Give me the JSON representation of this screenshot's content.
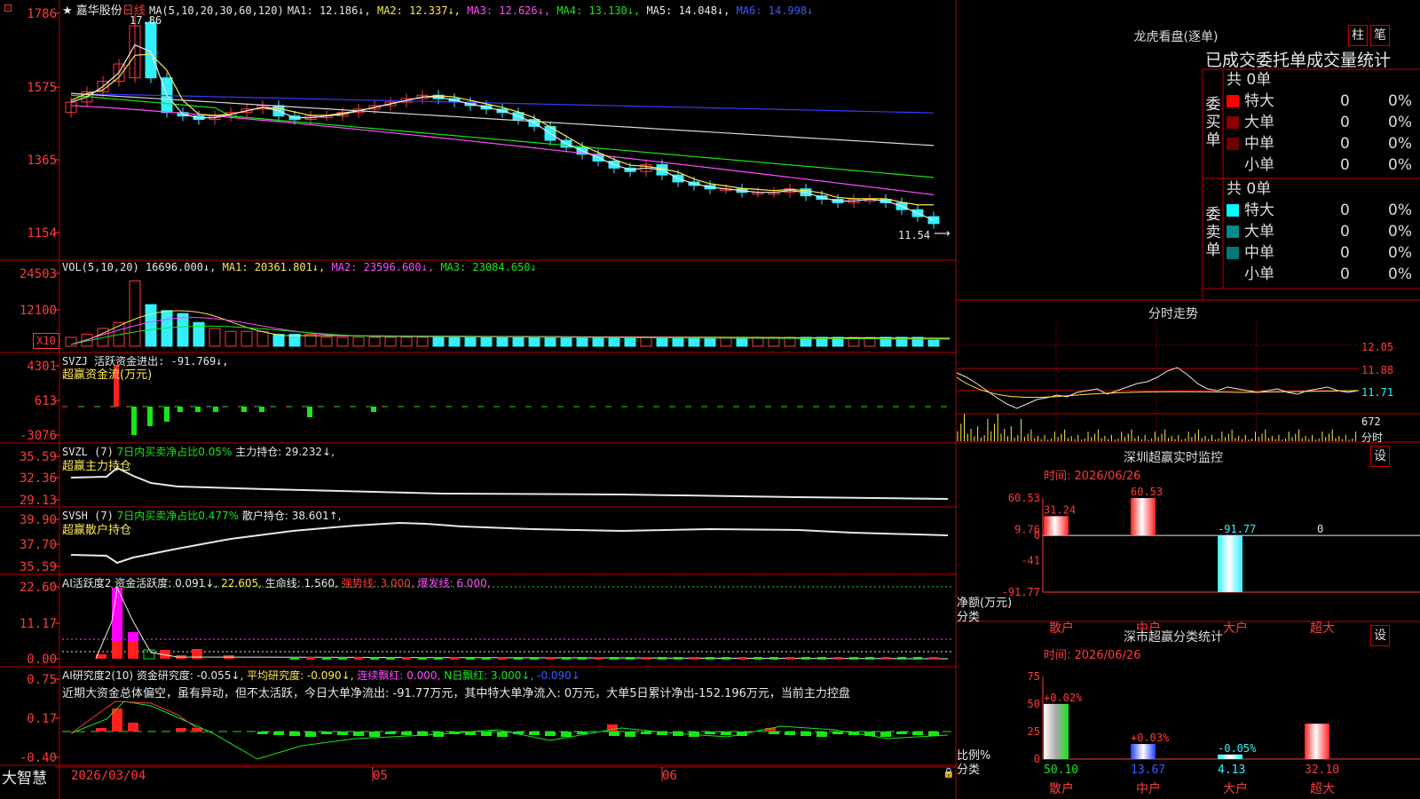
{
  "header": {
    "star": "★",
    "stock_name": "嘉华股份",
    "period": "日线",
    "ma_label": "MA(5,10,20,30,60,120)",
    "ma_values": [
      {
        "label": "MA1: 12.186↓,",
        "color": "#e8e8e8"
      },
      {
        "label": "MA2: 12.337↓,",
        "color": "#ffe94a"
      },
      {
        "label": "MA3: 12.626↓,",
        "color": "#ff4dff"
      },
      {
        "label": "MA4: 13.130↓,",
        "color": "#19e619"
      },
      {
        "label": "MA5: 14.048↓,",
        "color": "#e8e8e8"
      },
      {
        "label": "MA6: 14.998↓",
        "color": "#3a5bff"
      }
    ],
    "high_label": "17.86",
    "low_label": "11.54"
  },
  "axes": {
    "price": [
      "1786",
      "1575",
      "1365",
      "1154"
    ],
    "vol": [
      "24503",
      "12100"
    ],
    "vol_unit": "X10",
    "svzj": [
      "4301",
      "613",
      "-3076"
    ],
    "svzl": [
      "35.59",
      "32.36",
      "29.13"
    ],
    "svsh": [
      "39.90",
      "37.70",
      "35.59"
    ],
    "ai1": [
      "22.60",
      "11.17",
      "0.00"
    ],
    "ai2": [
      "0.75",
      "0.17",
      "-0.40"
    ]
  },
  "panes": {
    "vol": {
      "name": "VOL(5,10,20)",
      "value": "16696.000↓,",
      "ma1": "MA1: 20361.801↓,",
      "ma2": "MA2: 23596.600↓,",
      "ma3": "MA3: 23084.650↓"
    },
    "svzj": {
      "name": "SVZJ",
      "desc": "活跃资金进出: -91.769↓,",
      "sub": "超赢资金流(万元)"
    },
    "svzl": {
      "name": "SVZL (7)",
      "desc": "7日内买卖净占比0.05%",
      "hold": "主力持仓: 29.232↓,",
      "sub": "超赢主力持仓"
    },
    "svsh": {
      "name": "SVSH (7)",
      "desc": "7日内买卖净占比0.477%",
      "hold": "散户持仓: 38.601↑,",
      "sub": "超赢散户持仓"
    },
    "ai1": {
      "name": "AI活跃度2",
      "v1": "资金活跃度: 0.091↓,",
      "v2": "22.605,",
      "v3": "生命线: 1.560,",
      "v4": "强势线: 3.000,",
      "v5": "爆发线: 6.000,"
    },
    "ai2": {
      "name": "AI研究度2(10)",
      "v1": "资金研究度: -0.055↓,",
      "v2": "平均研究度: -0.090↓,",
      "v3": "连续飘红: 0.000,",
      "v4": "N日飘红: 3.000↓,",
      "v5": "-0.090↓",
      "summary": "近期大资金总体偏空，虽有异动，但不太活跃，今日大单净流出: -91.77万元，其中特大单净流入: 0万元，大单5日累计净出-152.196万元，当前主力控盘"
    }
  },
  "footer": {
    "brand": "大智慧",
    "dates": [
      "2026/03/04",
      "05",
      "06"
    ]
  },
  "right": {
    "lhb_title": "龙虎看盘(逐单)",
    "btn_zhu": "柱",
    "btn_bi": "笔",
    "stat_title": "已成交委托单成交量统计",
    "buy_label": "委买单",
    "sell_label": "委卖单",
    "buy_total": "共 0单",
    "sell_total": "共 0单",
    "buy_rows": [
      {
        "name": "特大",
        "count": "0",
        "pct": "0%",
        "color": "#ff0000"
      },
      {
        "name": "大单",
        "count": "0",
        "pct": "0%",
        "color": "#8b0000"
      },
      {
        "name": "中单",
        "count": "0",
        "pct": "0%",
        "color": "#6e0000"
      },
      {
        "name": "小单",
        "count": "0",
        "pct": "0%",
        "color": "#000000"
      }
    ],
    "sell_rows": [
      {
        "name": "特大",
        "count": "0",
        "pct": "0%",
        "color": "#00ffff"
      },
      {
        "name": "大单",
        "count": "0",
        "pct": "0%",
        "color": "#008b8b"
      },
      {
        "name": "中单",
        "count": "0",
        "pct": "0%",
        "color": "#007878"
      },
      {
        "name": "小单",
        "count": "0",
        "pct": "0%",
        "color": "#000000"
      }
    ],
    "fenshi_title": "分时走势",
    "fenshi_axis": [
      "12.05",
      "11.88",
      "11.71",
      "672"
    ],
    "fenshi_unit": "分时",
    "sz_monitor_title": "深圳超赢实时监控",
    "sz_btn": "设",
    "time_label": "时间: 2026/06/26",
    "monitor_axis": [
      "60.53",
      "9.76",
      "0",
      "-41",
      "-91.77"
    ],
    "monitor_yunit": "净额(万元)",
    "monitor_xunit": "分类",
    "class_stat_title": "深市超赢分类统计",
    "class_axis": [
      "75",
      "50",
      "25",
      "0"
    ],
    "class_yunit": "比例%",
    "class_xunit": "分类",
    "categories": [
      "散户",
      "中户",
      "大户",
      "超大"
    ]
  },
  "chart_data": [
    {
      "type": "candlestick",
      "title": "嘉华股份 日线",
      "ylim": [
        11.54,
        17.86
      ],
      "y_ticks": [
        17.86,
        15.75,
        13.65,
        11.54
      ],
      "x_ticks": [
        "2026/03/04",
        "05",
        "06"
      ],
      "annotations": [
        {
          "text": "17.86",
          "kind": "high"
        },
        {
          "text": "11.54",
          "kind": "low"
        }
      ],
      "series": [
        {
          "name": "MA1",
          "latest": 12.186
        },
        {
          "name": "MA2",
          "latest": 12.337
        },
        {
          "name": "MA3",
          "latest": 12.626
        },
        {
          "name": "MA4",
          "latest": 13.13
        },
        {
          "name": "MA5",
          "latest": 14.048
        },
        {
          "name": "MA6",
          "latest": 14.998
        }
      ]
    },
    {
      "type": "bar",
      "title": "VOL(5,10,20)",
      "latest": 16696.0,
      "y_ticks": [
        24503,
        12100
      ],
      "series": [
        {
          "name": "MA1",
          "latest": 20361.801
        },
        {
          "name": "MA2",
          "latest": 23596.6
        },
        {
          "name": "MA3",
          "latest": 23084.65
        }
      ]
    },
    {
      "type": "bar",
      "title": "深圳超赢实时监控",
      "categories": [
        "散户",
        "中户",
        "大户",
        "超大"
      ],
      "values": [
        31.24,
        60.53,
        -91.77,
        0
      ],
      "ylim": [
        -91.77,
        60.53
      ],
      "ylabel": "净额(万元)",
      "xlabel": "分类"
    },
    {
      "type": "bar",
      "title": "深市超赢分类统计",
      "categories": [
        "散户",
        "中户",
        "大户",
        "超大"
      ],
      "values": [
        50.1,
        13.67,
        4.13,
        32.1
      ],
      "changes": [
        "+0.02%",
        "+0.03%",
        "-0.05%",
        ""
      ],
      "ylim": [
        0,
        75
      ],
      "ylabel": "比例%",
      "xlabel": "分类"
    }
  ]
}
